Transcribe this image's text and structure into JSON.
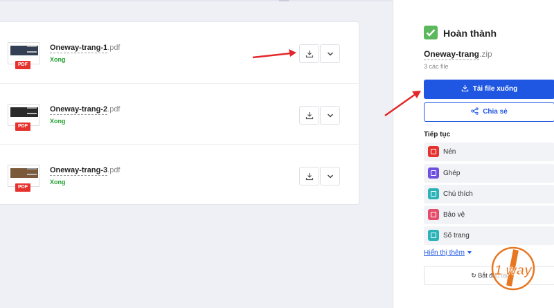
{
  "files": [
    {
      "base": "Oneway-trang-1",
      "ext": ".pdf",
      "status": "Xong",
      "badge": "PDF",
      "thumb_color": "#333f55"
    },
    {
      "base": "Oneway-trang-2",
      "ext": ".pdf",
      "status": "Xong",
      "badge": "PDF",
      "thumb_color": "#2a2a2a"
    },
    {
      "base": "Oneway-trang-3",
      "ext": ".pdf",
      "status": "Xong",
      "badge": "PDF",
      "thumb_color": "#7a5a3a"
    }
  ],
  "sidebar": {
    "done_title": "Hoàn thành",
    "zip_base": "Oneway-trang",
    "zip_ext": ".zip",
    "file_count": "3 các file",
    "download_label": "Tải file xuống",
    "share_label": "Chia sẻ",
    "continue_label": "Tiếp tục",
    "tools": [
      {
        "label": "Nén",
        "color": "#e5322d",
        "icon": "compress-icon"
      },
      {
        "label": "Ghép",
        "color": "#6f4fe0",
        "icon": "merge-icon"
      },
      {
        "label": "Chú thích",
        "color": "#2bb3b8",
        "icon": "pen-icon"
      },
      {
        "label": "Bảo vệ",
        "color": "#e54d6a",
        "icon": "lock-icon"
      },
      {
        "label": "Số trang",
        "color": "#2bb3b8",
        "icon": "page-number-icon"
      }
    ],
    "more_label": "Hiển thị thêm",
    "restart_label": "Bắt đầu lại"
  },
  "colors": {
    "primary": "#1f57e3",
    "success": "#23a233",
    "arrow": "#e3262a",
    "watermark": "#e87722"
  },
  "watermark_text": "1 way"
}
